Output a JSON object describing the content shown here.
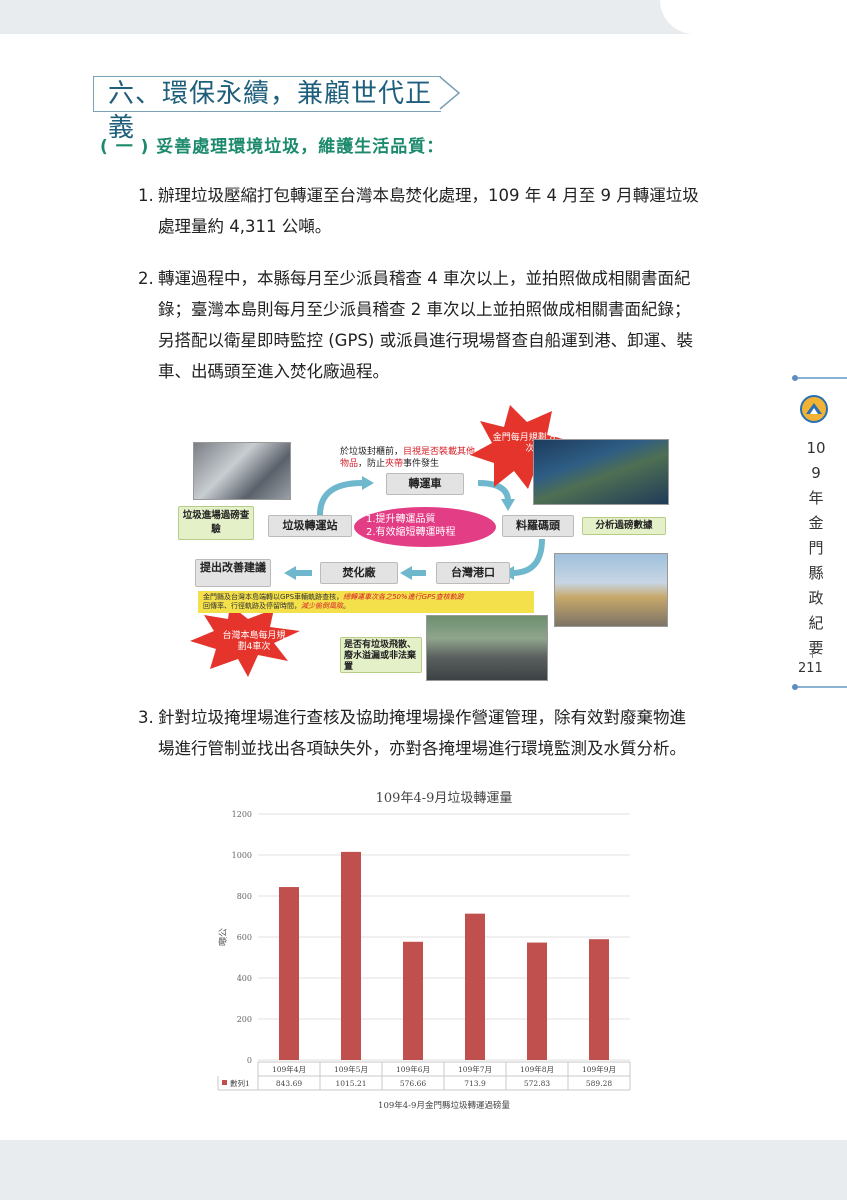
{
  "section": {
    "title": "六、環保永續，兼顧世代正義",
    "subtitle": "( 一 ) 妥善處理環境垃圾，維護生活品質："
  },
  "paragraphs": [
    {
      "num": "1.",
      "lines": [
        "辦理垃圾壓縮打包轉運至台灣本島焚化處理，109 年 4 月至 9 月轉運垃圾",
        "處理量約 4,311 公噸。"
      ]
    },
    {
      "num": "2.",
      "lines": [
        "轉運過程中，本縣每月至少派員稽查 4 車次以上，並拍照做成相關書面紀",
        "錄；臺灣本島則每月至少派員稽查 2 車次以上並拍照做成相關書面紀錄；",
        "另搭配以衛星即時監控 (GPS) 或派員進行現場督查自船運到港、卸運、裝",
        "車、出碼頭至進入焚化廠過程。"
      ]
    },
    {
      "num": "3.",
      "lines": [
        "針對垃圾掩埋場進行查核及協助掩埋場操作營運管理，除有效對廢棄物進",
        "場進行管制並找出各項缺失外，亦對各掩埋場進行環境監測及水質分析。"
      ]
    }
  ],
  "sidebar": {
    "vertical_text": "109年金門縣政紀要",
    "page_number": "211"
  },
  "diagram": {
    "note_top_line1": "於垃圾封櫃前，",
    "note_top_red1": "目視是否裝載其他",
    "note_top_red2": "物品",
    "note_top_mid": "，防止",
    "note_top_red3": "夾帶",
    "note_top_end": "事件發生",
    "node_truck": "轉運車",
    "node_station": "垃圾轉運站",
    "node_dock": "料羅碼頭",
    "node_port": "台灣港口",
    "node_incinerator": "焚化廠",
    "node_improve": "提出改善建議",
    "note_left": "垃圾進場過磅查驗",
    "note_right": "分析過磅數據",
    "center_line1": "1.提升轉運品質",
    "center_line2": "2.有效縮短轉運時程",
    "burst_top": "金門每月規劃 8 車次",
    "burst_bottom": "台灣本島每月規劃4車次",
    "yellow_note_a": "金門縣及台灣本島端轉以GPS車輛軌跡查核，",
    "yellow_note_red1": "總轉運車次各之50%進行GPS查核軌跡",
    "yellow_note_b": "回傳率、行徑軌跡及停留時間，",
    "yellow_note_red2": "減少偷倒風險",
    "yellow_note_c": "。",
    "note_bottom": "是否有垃圾飛散、廢水溢漏或非法棄置"
  },
  "chart_data": {
    "type": "bar",
    "title": "109年4-9月垃圾轉運量",
    "xlabel": "109年4-9月金門縣垃圾轉運過磅量",
    "ylabel": "噸公",
    "categories": [
      "109年4月",
      "109年5月",
      "109年6月",
      "109年7月",
      "109年8月",
      "109年9月"
    ],
    "series": [
      {
        "name": "數列1",
        "values": [
          843.69,
          1015.21,
          576.66,
          713.9,
          572.83,
          589.28
        ],
        "value_labels": [
          "843.69",
          "1015.21",
          "576.66",
          "713.9",
          "572.83",
          "589.28"
        ],
        "color": "#c0504d"
      }
    ],
    "yticks": [
      0,
      200,
      400,
      600,
      800,
      1000,
      1200
    ],
    "ylim": [
      0,
      1200
    ],
    "grid": true,
    "legend": "data-table"
  },
  "colors": {
    "title": "#1f5f7c",
    "subtitle": "#1c8a6d",
    "bar": "#c0504d",
    "sidebar_accent": "#5c8fc0",
    "center_oval": "#e33d86"
  }
}
